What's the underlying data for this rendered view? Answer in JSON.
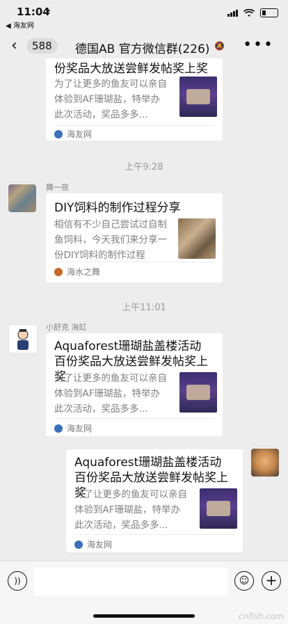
{
  "status_bar": {
    "time": "11:04",
    "location_arrow": "➚",
    "back_app": "◀ 海友网"
  },
  "nav": {
    "back_label": "588",
    "title": "德国AB  官方微信群(226)",
    "mute_icon": "🔕",
    "more": "•••"
  },
  "messages": [
    {
      "title": "份奖品大放送尝鲜发帖奖上奖",
      "description": "为了让更多的鱼友可以亲自体验到AF珊瑚盐，特举办此次活动，奖品多多...",
      "source": "海友网"
    },
    {
      "timestamp": "上午9:28",
      "sender": "舞一夜",
      "title": "DIY饲料的制作过程分享",
      "description": "相信有不少自己尝试过自制鱼饲料，今天我们来分享一份DIY饲料的制作过程",
      "source": "海水之舞"
    },
    {
      "timestamp": "上午11:01",
      "sender": "小舒克 海缸",
      "title": "Aquaforest珊瑚盐盖楼活动 百份奖品大放送尝鲜发帖奖上奖",
      "description": "为了让更多的鱼友可以亲自体验到AF珊瑚盐，特举办此次活动，奖品多多...",
      "source": "海友网"
    },
    {
      "title": "Aquaforest珊瑚盐盖楼活动 百份奖品大放送尝鲜发帖奖上奖",
      "description": "为了让更多的鱼友可以亲自体验到AF珊瑚盐，特举办此次活动，奖品多多...",
      "source": "海友网"
    }
  ],
  "input": {
    "placeholder": ""
  },
  "watermark": "cnfish.com",
  "colors": {
    "background": "#ededed",
    "card": "#ffffff",
    "source_icon": "#3d6fb8"
  }
}
